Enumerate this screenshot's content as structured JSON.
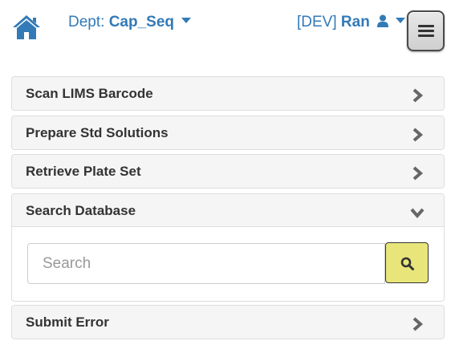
{
  "header": {
    "dept_prefix": "Dept:",
    "dept_name": "Cap_Seq",
    "env_tag": "[DEV]",
    "user_name": "Ran"
  },
  "panels": [
    {
      "title": "Scan LIMS Barcode",
      "expanded": false
    },
    {
      "title": "Prepare Std Solutions",
      "expanded": false
    },
    {
      "title": "Retrieve Plate Set",
      "expanded": false
    },
    {
      "title": "Search Database",
      "expanded": true
    },
    {
      "title": "Submit Error",
      "expanded": false
    }
  ],
  "search": {
    "placeholder": "Search",
    "value": ""
  },
  "icons": {
    "home": "home-icon",
    "user": "user-icon",
    "menu": "hamburger-icon",
    "collapsed": "chevron-right-icon",
    "expanded": "chevron-down-icon",
    "search": "search-icon"
  },
  "colors": {
    "link": "#337ab7",
    "search_button": "#e8e67a",
    "panel_heading": "#f5f5f5"
  }
}
